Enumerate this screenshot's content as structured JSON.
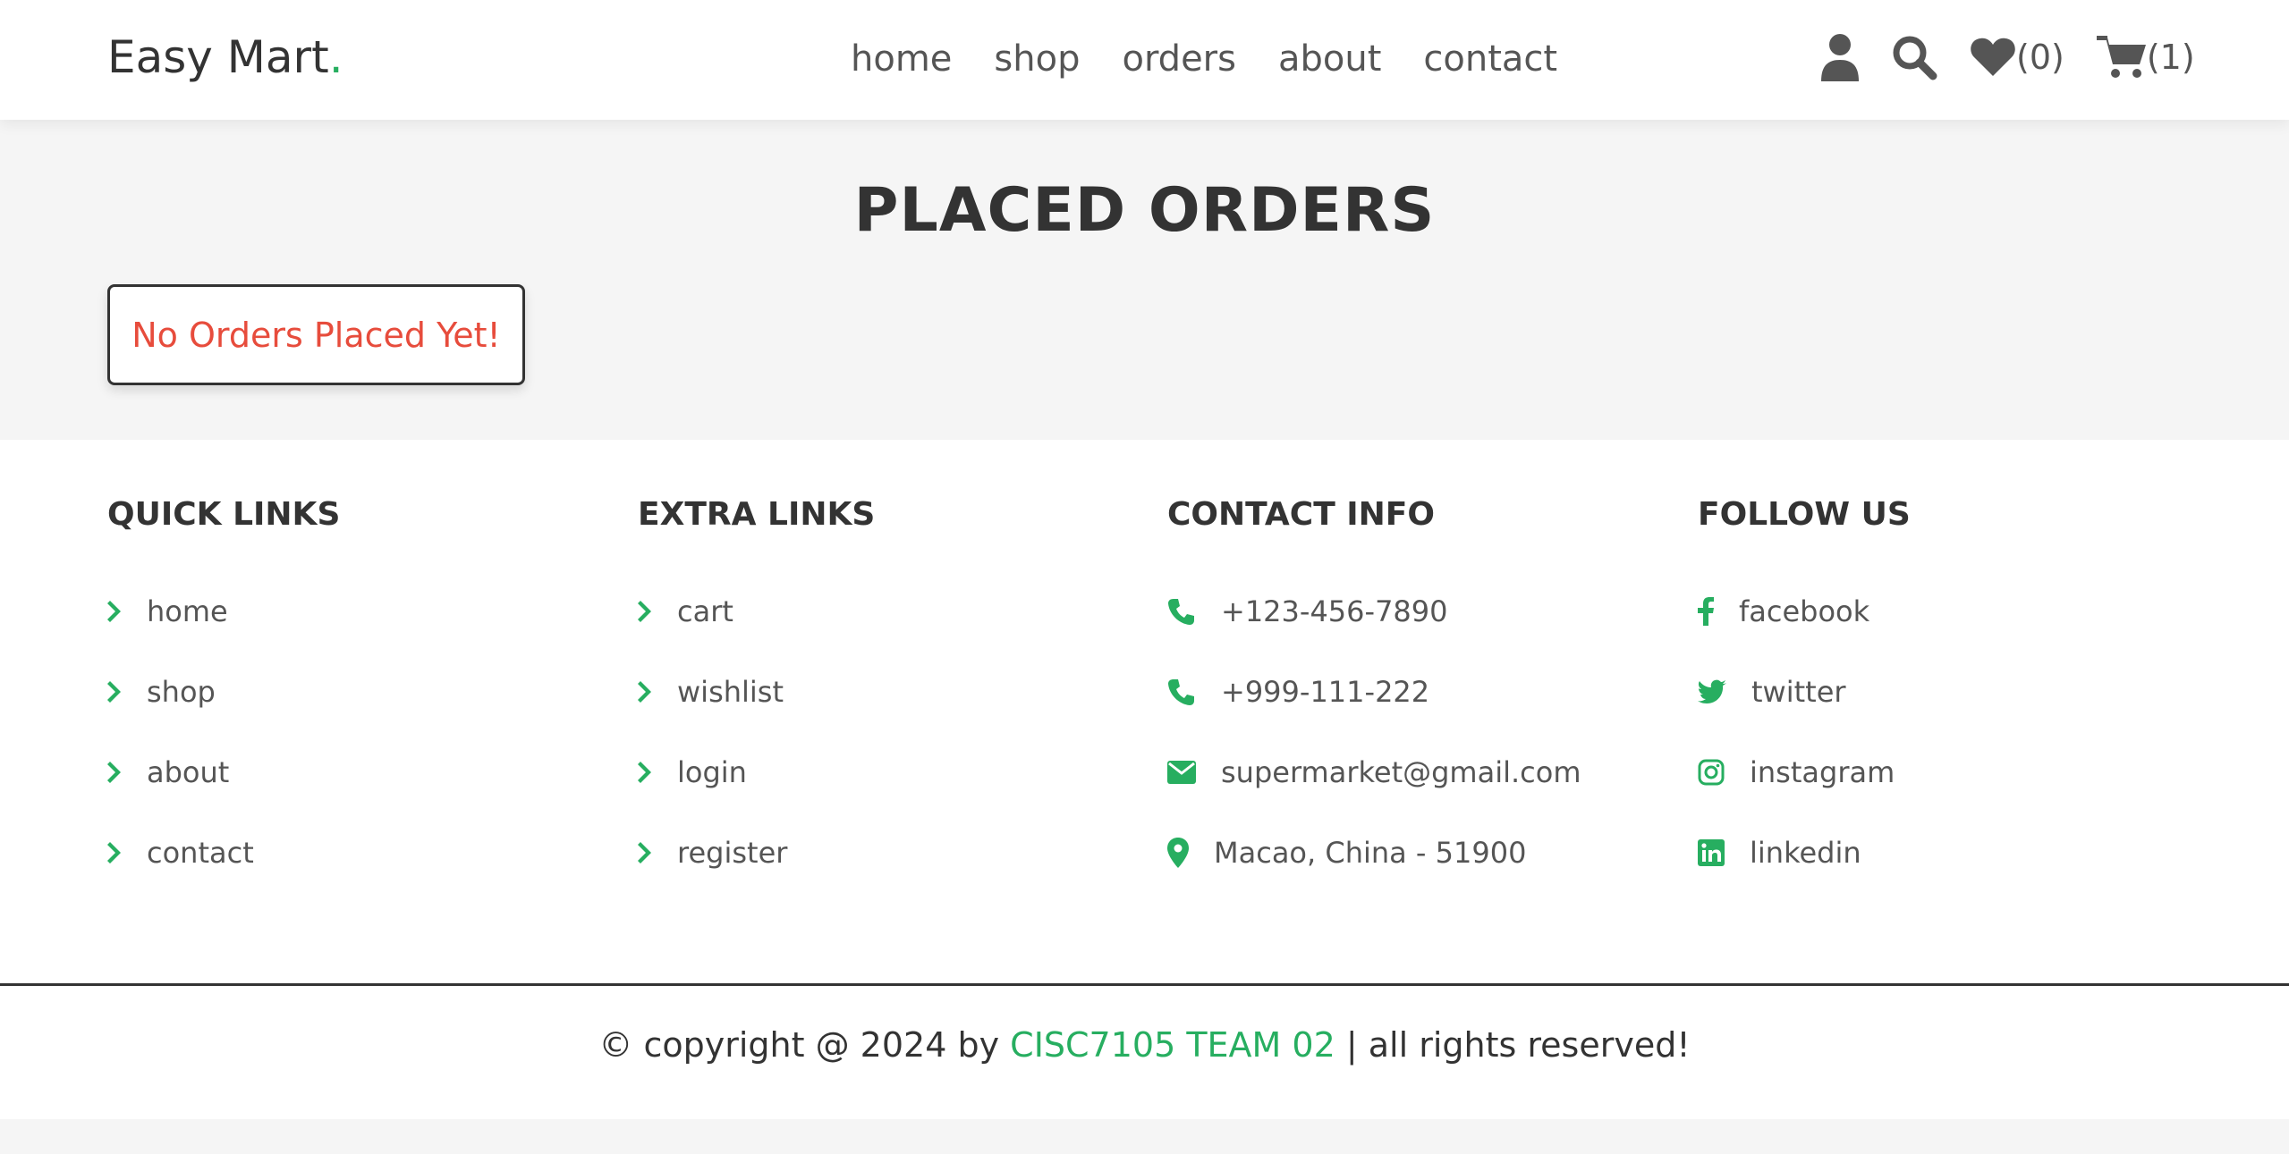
{
  "header": {
    "logo_text": "Easy Mart",
    "logo_dot": ".",
    "nav": [
      "home",
      "shop",
      "orders",
      "about",
      "contact"
    ],
    "wishlist_count": "(0)",
    "cart_count": "(1)"
  },
  "orders": {
    "title": "PLACED ORDERS",
    "empty_message": "No Orders Placed Yet!"
  },
  "footer": {
    "quick_links": {
      "title": "QUICK LINKS",
      "items": [
        "home",
        "shop",
        "about",
        "contact"
      ]
    },
    "extra_links": {
      "title": "EXTRA LINKS",
      "items": [
        "cart",
        "wishlist",
        "login",
        "register"
      ]
    },
    "contact_info": {
      "title": "CONTACT INFO",
      "items": [
        "+123-456-7890",
        "+999-111-222",
        "supermarket@gmail.com",
        "Macao, China - 51900"
      ]
    },
    "follow_us": {
      "title": "FOLLOW US",
      "items": [
        "facebook",
        "twitter",
        "instagram",
        "linkedin"
      ]
    },
    "credit_prefix": "© copyright @ 2024 by ",
    "credit_team": "CISC7105 TEAM 02",
    "credit_suffix": " | all rights reserved!"
  },
  "colors": {
    "accent": "#27ae60",
    "error": "#e74c3c",
    "text_dark": "#333333",
    "text_muted": "#555555",
    "background": "#f5f5f5"
  },
  "icons": {
    "header": [
      "user-icon",
      "search-icon",
      "heart-icon",
      "cart-icon"
    ],
    "footer_link": "chevron-right-icon",
    "contact": [
      "phone-icon",
      "phone-icon",
      "envelope-icon",
      "map-marker-icon"
    ],
    "social": [
      "facebook-icon",
      "twitter-icon",
      "instagram-icon",
      "linkedin-icon"
    ]
  }
}
